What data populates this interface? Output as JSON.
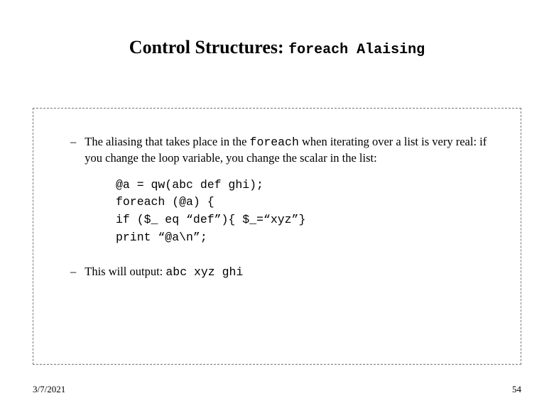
{
  "title": {
    "main": "Control Structures:",
    "mono": "foreach Alaising"
  },
  "bullets": {
    "b1_pre": "The aliasing that takes place in the ",
    "b1_code": "foreach",
    "b1_post": " when iterating over a list is very real: if you change the loop variable, you change the scalar in the list:",
    "b2_pre": "This will output: ",
    "b2_code": "abc xyz ghi"
  },
  "code": "@a = qw(abc def ghi);\nforeach (@a) {\nif ($_ eq “def”){ $_=“xyz”}\nprint “@a\\n”;",
  "footer": {
    "date": "3/7/2021",
    "page": "54"
  },
  "dash": "–"
}
